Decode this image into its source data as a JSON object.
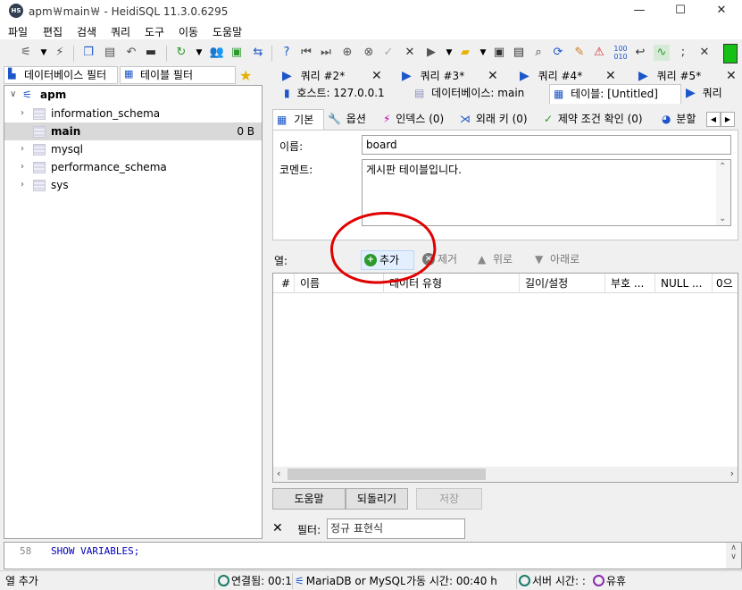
{
  "window": {
    "title": "apm￦main￦ - HeidiSQL 11.3.0.6295",
    "app_icon_text": "HS",
    "controls": [
      "—",
      "☐",
      "✕"
    ]
  },
  "menu": [
    "파일",
    "편집",
    "검색",
    "쿼리",
    "도구",
    "이동",
    "도움말"
  ],
  "left": {
    "db_filter_placeholder": "데이터베이스 필터",
    "table_filter_placeholder": "테이블 필터",
    "tree": {
      "root": "apm",
      "items": [
        {
          "name": "information_schema",
          "size": ""
        },
        {
          "name": "main",
          "size": "0 B"
        },
        {
          "name": "mysql",
          "size": ""
        },
        {
          "name": "performance_schema",
          "size": ""
        },
        {
          "name": "sys",
          "size": ""
        }
      ]
    }
  },
  "query_tabs": [
    "쿼리 #2*",
    "쿼리 #3*",
    "쿼리 #4*",
    "쿼리 #5*"
  ],
  "context_tabs": {
    "host": "호스트: 127.0.0.1",
    "database": "데이터베이스: main",
    "table": "테이블: [Untitled]",
    "query": "쿼리"
  },
  "editor": {
    "sub_tabs": [
      "기본",
      "옵션",
      "인덱스 (0)",
      "외래 키 (0)",
      "제약 조건 확인 (0)",
      "분할"
    ],
    "name_label": "이름:",
    "name_value": "board",
    "comment_label": "코멘트:",
    "comment_value": "게시판 테이블입니다.",
    "columns_label": "열:",
    "col_actions": {
      "add": "추가",
      "remove": "제거",
      "up": "위로",
      "down": "아래로"
    },
    "grid_headers": [
      "#",
      "이름",
      "데이터 유형",
      "길이/설정",
      "부호 ...",
      "NULL ...",
      "0으"
    ],
    "buttons": {
      "help": "도움말",
      "revert": "되돌리기",
      "save": "저장"
    },
    "filter_label": "필터:",
    "filter_placeholder": "정규 표현식"
  },
  "sql_log": {
    "line": "58",
    "text": "SHOW VARIABLES;"
  },
  "status": {
    "left": "열 추가",
    "connected": "연결됨: 00:1",
    "server": "MariaDB or MySQL",
    "uptime": "가동 시간: 00:40 h",
    "server_time": "서버 시간: :",
    "idle": "유휴"
  },
  "colors": {
    "accent": "#1c56c8",
    "annotation": "#e00000",
    "selection": "#d9d9d9"
  }
}
